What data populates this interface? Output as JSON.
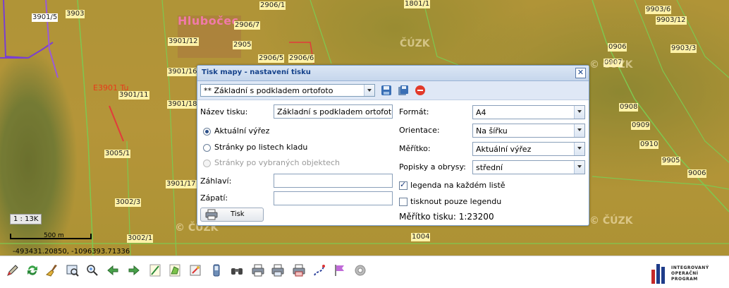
{
  "map": {
    "town_label": "Hlubočec",
    "red_label": "E3901 Tu",
    "parcels": [
      "3901/5",
      "3903",
      "2906/1",
      "1801/1",
      "9903/6",
      "9903/12",
      "2906/7",
      "3901/12",
      "2905",
      "9903/3",
      "2906/5",
      "2906/6",
      "3901/16",
      "0906",
      "0907",
      "3901/11",
      "3901/18",
      "0908",
      "0909",
      "0910",
      "3005/1",
      "9905",
      "3901/17",
      "9006",
      "3002/3",
      "3002/1",
      "1004"
    ],
    "watermarks": [
      "ČÚZK",
      "© ČÚZK",
      "© ČÚZK",
      "© ČÚZK"
    ],
    "scale_text": "1 : 13K",
    "scalebar_label": "500 m",
    "coordinates": "-493431.20850, -1096393.71336"
  },
  "dialog": {
    "title": "Tisk mapy - nastavení tisku",
    "close_glyph": "✕",
    "preset_value": "** Základní s podkladem ortofoto",
    "print_name_label": "Název tisku:",
    "print_name_value": "Základní s podkladem ortofoto",
    "radio_current": "Aktuální výřez",
    "radio_sheets": "Stránky po listech kladu",
    "radio_objects": "Stránky po vybraných objektech",
    "header_label": "Záhlaví:",
    "header_value": "",
    "footer_label": "Zápatí:",
    "footer_value": "",
    "print_button": "Tisk",
    "format_label": "Formát:",
    "format_value": "A4",
    "orientation_label": "Orientace:",
    "orientation_value": "Na šířku",
    "scale_label": "Měřítko:",
    "scale_value": "Aktuální výřez",
    "labels_label": "Popisky a obrysy:",
    "labels_value": "střední",
    "legend_each_sheet": "legenda na každém listě",
    "legend_each_sheet_checked": true,
    "legend_only": "tisknout pouze legendu",
    "legend_only_checked": false,
    "print_scale": "Měřítko tisku: 1:23200"
  },
  "bottombar": {
    "icons": [
      "edit-icon",
      "refresh-icon",
      "broom-icon",
      "zoom-window-icon",
      "zoom-extent-icon",
      "back-icon",
      "forward-icon",
      "measure-line-icon",
      "measure-area-icon",
      "draw-icon",
      "gps-icon",
      "binoculars-icon",
      "print-icon",
      "print-settings-icon",
      "print-pdf-icon",
      "route-icon",
      "flag-icon",
      "settings-icon"
    ],
    "logo_lines": [
      "INTEGROVANÝ",
      "OPERAČNÍ",
      "PROGRAM"
    ]
  }
}
